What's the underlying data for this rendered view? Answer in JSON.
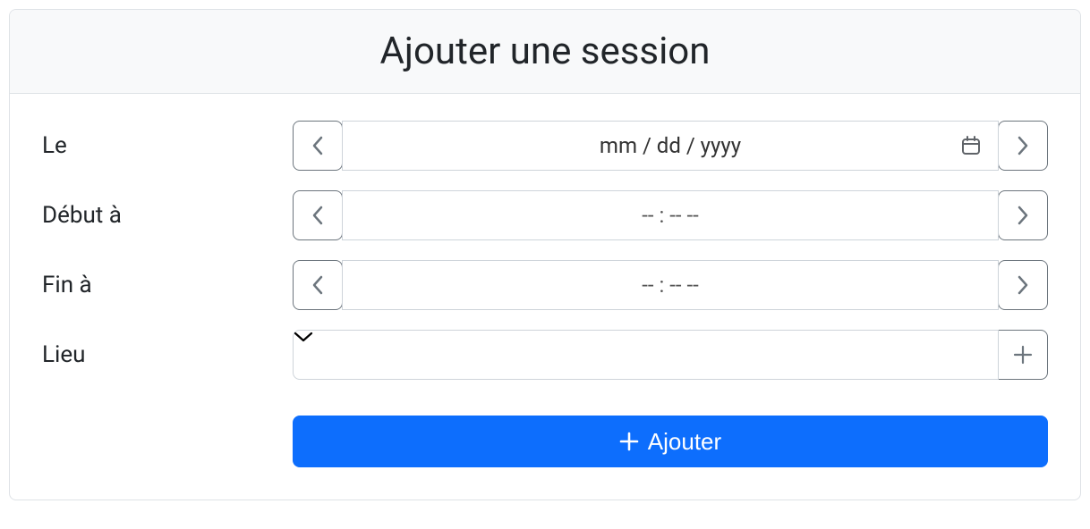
{
  "title": "Ajouter une session",
  "fields": {
    "date": {
      "label": "Le",
      "placeholder": "mm / dd / yyyy"
    },
    "start": {
      "label": "Début à",
      "placeholder": "-- : --   --"
    },
    "end": {
      "label": "Fin à",
      "placeholder": "-- : --   --"
    },
    "location": {
      "label": "Lieu"
    }
  },
  "submit": {
    "label": "Ajouter"
  }
}
